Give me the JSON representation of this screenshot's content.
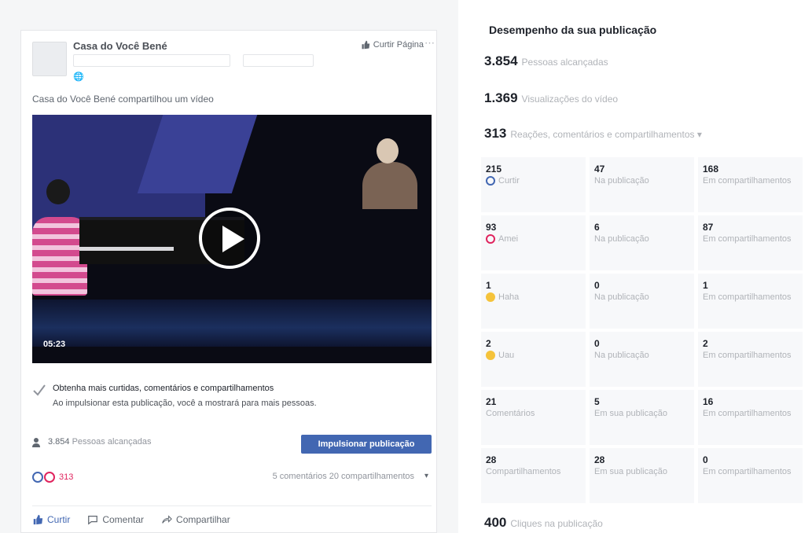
{
  "post": {
    "page_name": "Casa do Você Bené",
    "like_page_label": "Curtir Página",
    "share_line": "Casa do Você Bené compartilhou um vídeo",
    "video_duration": "05:23",
    "notice_title": "Obtenha mais curtidas, comentários e compartilhamentos",
    "notice_body": "Ao impulsionar esta publicação, você a mostrará para mais pessoas.",
    "reach_count": "3.854",
    "reach_label": "Pessoas alcançadas",
    "boost_label": "Impulsionar publicação",
    "comments_shares": "5 comentários  20 compartilhamentos",
    "actions": [
      "Curtir",
      "Comentar",
      "Compartilhar"
    ]
  },
  "panel": {
    "title": "Desempenho da sua publicação",
    "stats": [
      {
        "num": "3.854",
        "label": "Pessoas alcançadas"
      },
      {
        "num": "1.369",
        "label": "Visualizações do vídeo"
      },
      {
        "num": "313",
        "label": "Reações, comentários e compartilhamentos ▾"
      },
      {
        "num": "400",
        "label": "Cliques na publicação"
      }
    ],
    "grid": [
      [
        {
          "v": "215",
          "l": "Curtir",
          "icon": "like"
        },
        {
          "v": "47",
          "l": "Na publicação"
        },
        {
          "v": "168",
          "l": "Em compartilhamentos"
        }
      ],
      [
        {
          "v": "93",
          "l": "Amei",
          "icon": "love"
        },
        {
          "v": "6",
          "l": "Na publicação"
        },
        {
          "v": "87",
          "l": "Em compartilhamentos"
        }
      ],
      [
        {
          "v": "1",
          "l": "Haha",
          "icon": "haha"
        },
        {
          "v": "0",
          "l": "Na publicação"
        },
        {
          "v": "1",
          "l": "Em compartilhamentos"
        }
      ],
      [
        {
          "v": "2",
          "l": "Uau",
          "icon": "wow"
        },
        {
          "v": "0",
          "l": "Na publicação"
        },
        {
          "v": "2",
          "l": "Em compartilhamentos"
        }
      ],
      [
        {
          "v": "21",
          "l": "Comentários"
        },
        {
          "v": "5",
          "l": "Em sua publicação"
        },
        {
          "v": "16",
          "l": "Em compartilhamentos"
        }
      ],
      [
        {
          "v": "28",
          "l": "Compartilhamentos"
        },
        {
          "v": "28",
          "l": "Em sua publicação"
        },
        {
          "v": "0",
          "l": "Em compartilhamentos"
        }
      ]
    ]
  }
}
